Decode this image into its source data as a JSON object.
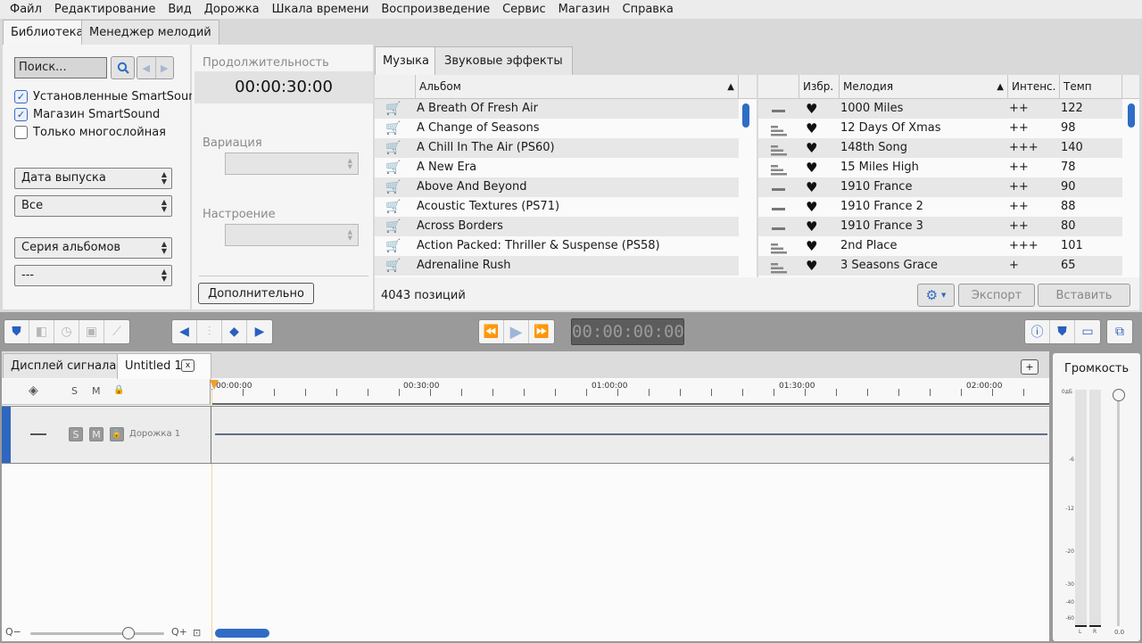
{
  "menu": [
    "Файл",
    "Редактирование",
    "Вид",
    "Дорожка",
    "Шкала времени",
    "Воспроизведение",
    "Сервис",
    "Магазин",
    "Справка"
  ],
  "main_tabs": [
    "Библиотека",
    "Менеджер мелодий"
  ],
  "search": {
    "placeholder": "Поиск..."
  },
  "filters": {
    "installed": "Установленные SmartSound",
    "store": "Магазин SmartSound",
    "layered": "Только многослойная",
    "sort_by": "Дата выпуска",
    "sort_range": "Все",
    "series": "Серия альбомов",
    "series_value": "---"
  },
  "details": {
    "duration_label": "Продолжительность",
    "duration_value": "00:00:30:00",
    "variation_label": "Вариация",
    "mood_label": "Настроение",
    "more_button": "Дополнительно"
  },
  "lib_tabs": [
    "Музыка",
    "Звуковые эффекты"
  ],
  "album_header": "Альбом",
  "albums": [
    "A Breath Of Fresh Air",
    "A Change of Seasons",
    "A Chill In The Air (PS60)",
    "A New Era",
    "Above And Beyond",
    "Acoustic Textures (PS71)",
    "Across Borders",
    "Action Packed: Thriller & Suspense (PS58)",
    "Adrenaline Rush"
  ],
  "song_headers": {
    "fav": "Избр.",
    "song": "Мелодия",
    "intensity": "Интенс.",
    "tempo": "Темп"
  },
  "songs": [
    {
      "name": "1000 Miles",
      "int": "++",
      "tempo": "122",
      "layered": false
    },
    {
      "name": "12 Days Of Xmas",
      "int": "++",
      "tempo": "98",
      "layered": true
    },
    {
      "name": "148th Song",
      "int": "+++",
      "tempo": "140",
      "layered": true
    },
    {
      "name": "15 Miles High",
      "int": "++",
      "tempo": "78",
      "layered": true
    },
    {
      "name": "1910 France",
      "int": "++",
      "tempo": "90",
      "layered": false
    },
    {
      "name": "1910 France 2",
      "int": "++",
      "tempo": "88",
      "layered": false
    },
    {
      "name": "1910 France 3",
      "int": "++",
      "tempo": "80",
      "layered": false
    },
    {
      "name": "2nd Place",
      "int": "+++",
      "tempo": "101",
      "layered": true
    },
    {
      "name": "3 Seasons Grace",
      "int": "+",
      "tempo": "65",
      "layered": true
    }
  ],
  "footer": {
    "count": "4043 позиций",
    "export": "Экспорт",
    "insert": "Вставить"
  },
  "timecode": "00:00:00:00",
  "timeline_tabs": {
    "waveform": "Дисплей сигнала",
    "project": "Untitled 1",
    "close": "x",
    "add": "+"
  },
  "track_header": {
    "solo": "S",
    "mute": "M"
  },
  "track": {
    "name": "Дорожка 1",
    "solo": "S",
    "mute": "M"
  },
  "ruler": [
    "00:00:00",
    "00:30:00",
    "01:00:00",
    "01:30:00",
    "02:00:00"
  ],
  "volume": {
    "title": "Громкость",
    "marks": [
      "0дБ",
      "-6",
      "-12",
      "-20",
      "-30",
      "-40",
      "-60"
    ],
    "left": "L",
    "right": "R",
    "value": "0.0",
    "level": 0
  },
  "colors": {
    "accent": "#2f6cc4",
    "playhead": "#f0a030",
    "track_stripe": "#2e66c0"
  }
}
